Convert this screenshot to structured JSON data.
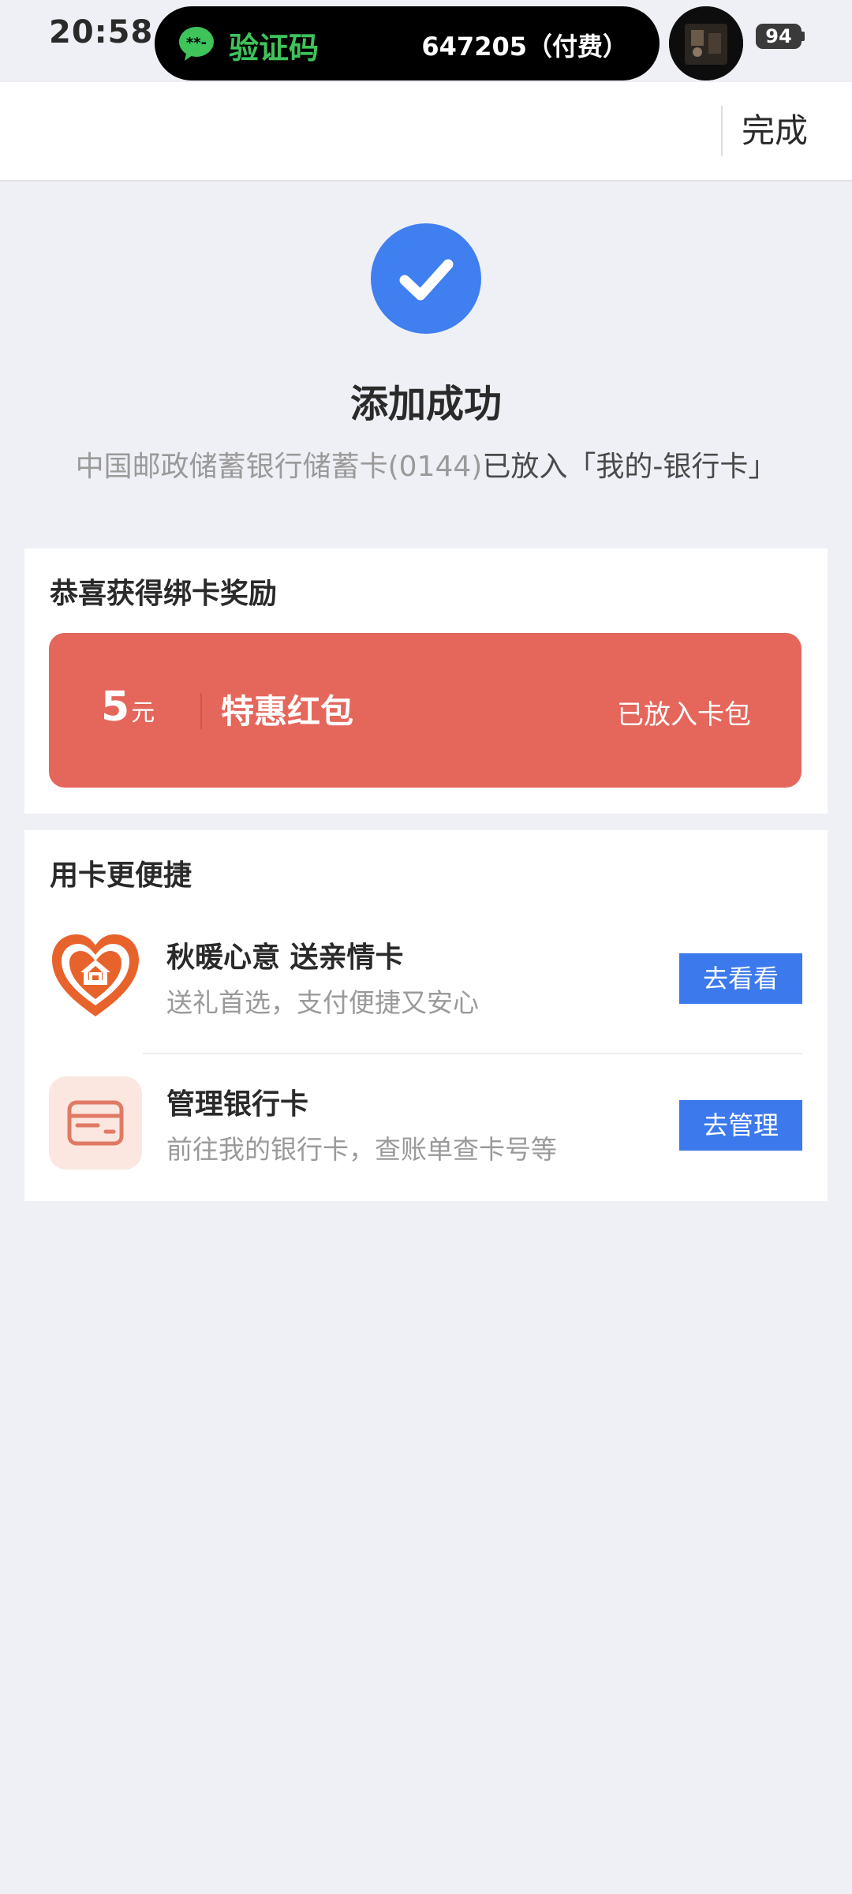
{
  "status_bar": {
    "time": "20:58",
    "notification_title": "验证码",
    "notification_code": "647205（付费）",
    "battery": "94"
  },
  "header": {
    "done_label": "完成"
  },
  "success": {
    "title": "添加成功",
    "desc_card": "中国邮政储蓄银行储蓄卡(0144)",
    "desc_dest": "已放入「我的-银行卡」"
  },
  "reward": {
    "section_title": "恭喜获得绑卡奖励",
    "amount": "5",
    "unit": "元",
    "name": "特惠红包",
    "status": "已放入卡包"
  },
  "shortcuts": {
    "section_title": "用卡更便捷",
    "items": [
      {
        "title": "秋暖心意 送亲情卡",
        "subtitle": "送礼首选，支付便捷又安心",
        "button": "去看看",
        "icon": "heart-home-icon"
      },
      {
        "title": "管理银行卡",
        "subtitle": "前往我的银行卡，查账单查卡号等",
        "button": "去管理",
        "icon": "bank-card-icon"
      }
    ]
  },
  "colors": {
    "accent_blue": "#3c79ec",
    "success_blue": "#3f7ff0",
    "coupon_red": "#e5665b",
    "heart_orange": "#e8622c",
    "wechat_green": "#3ec45a",
    "page_bg": "#eff0f5"
  }
}
